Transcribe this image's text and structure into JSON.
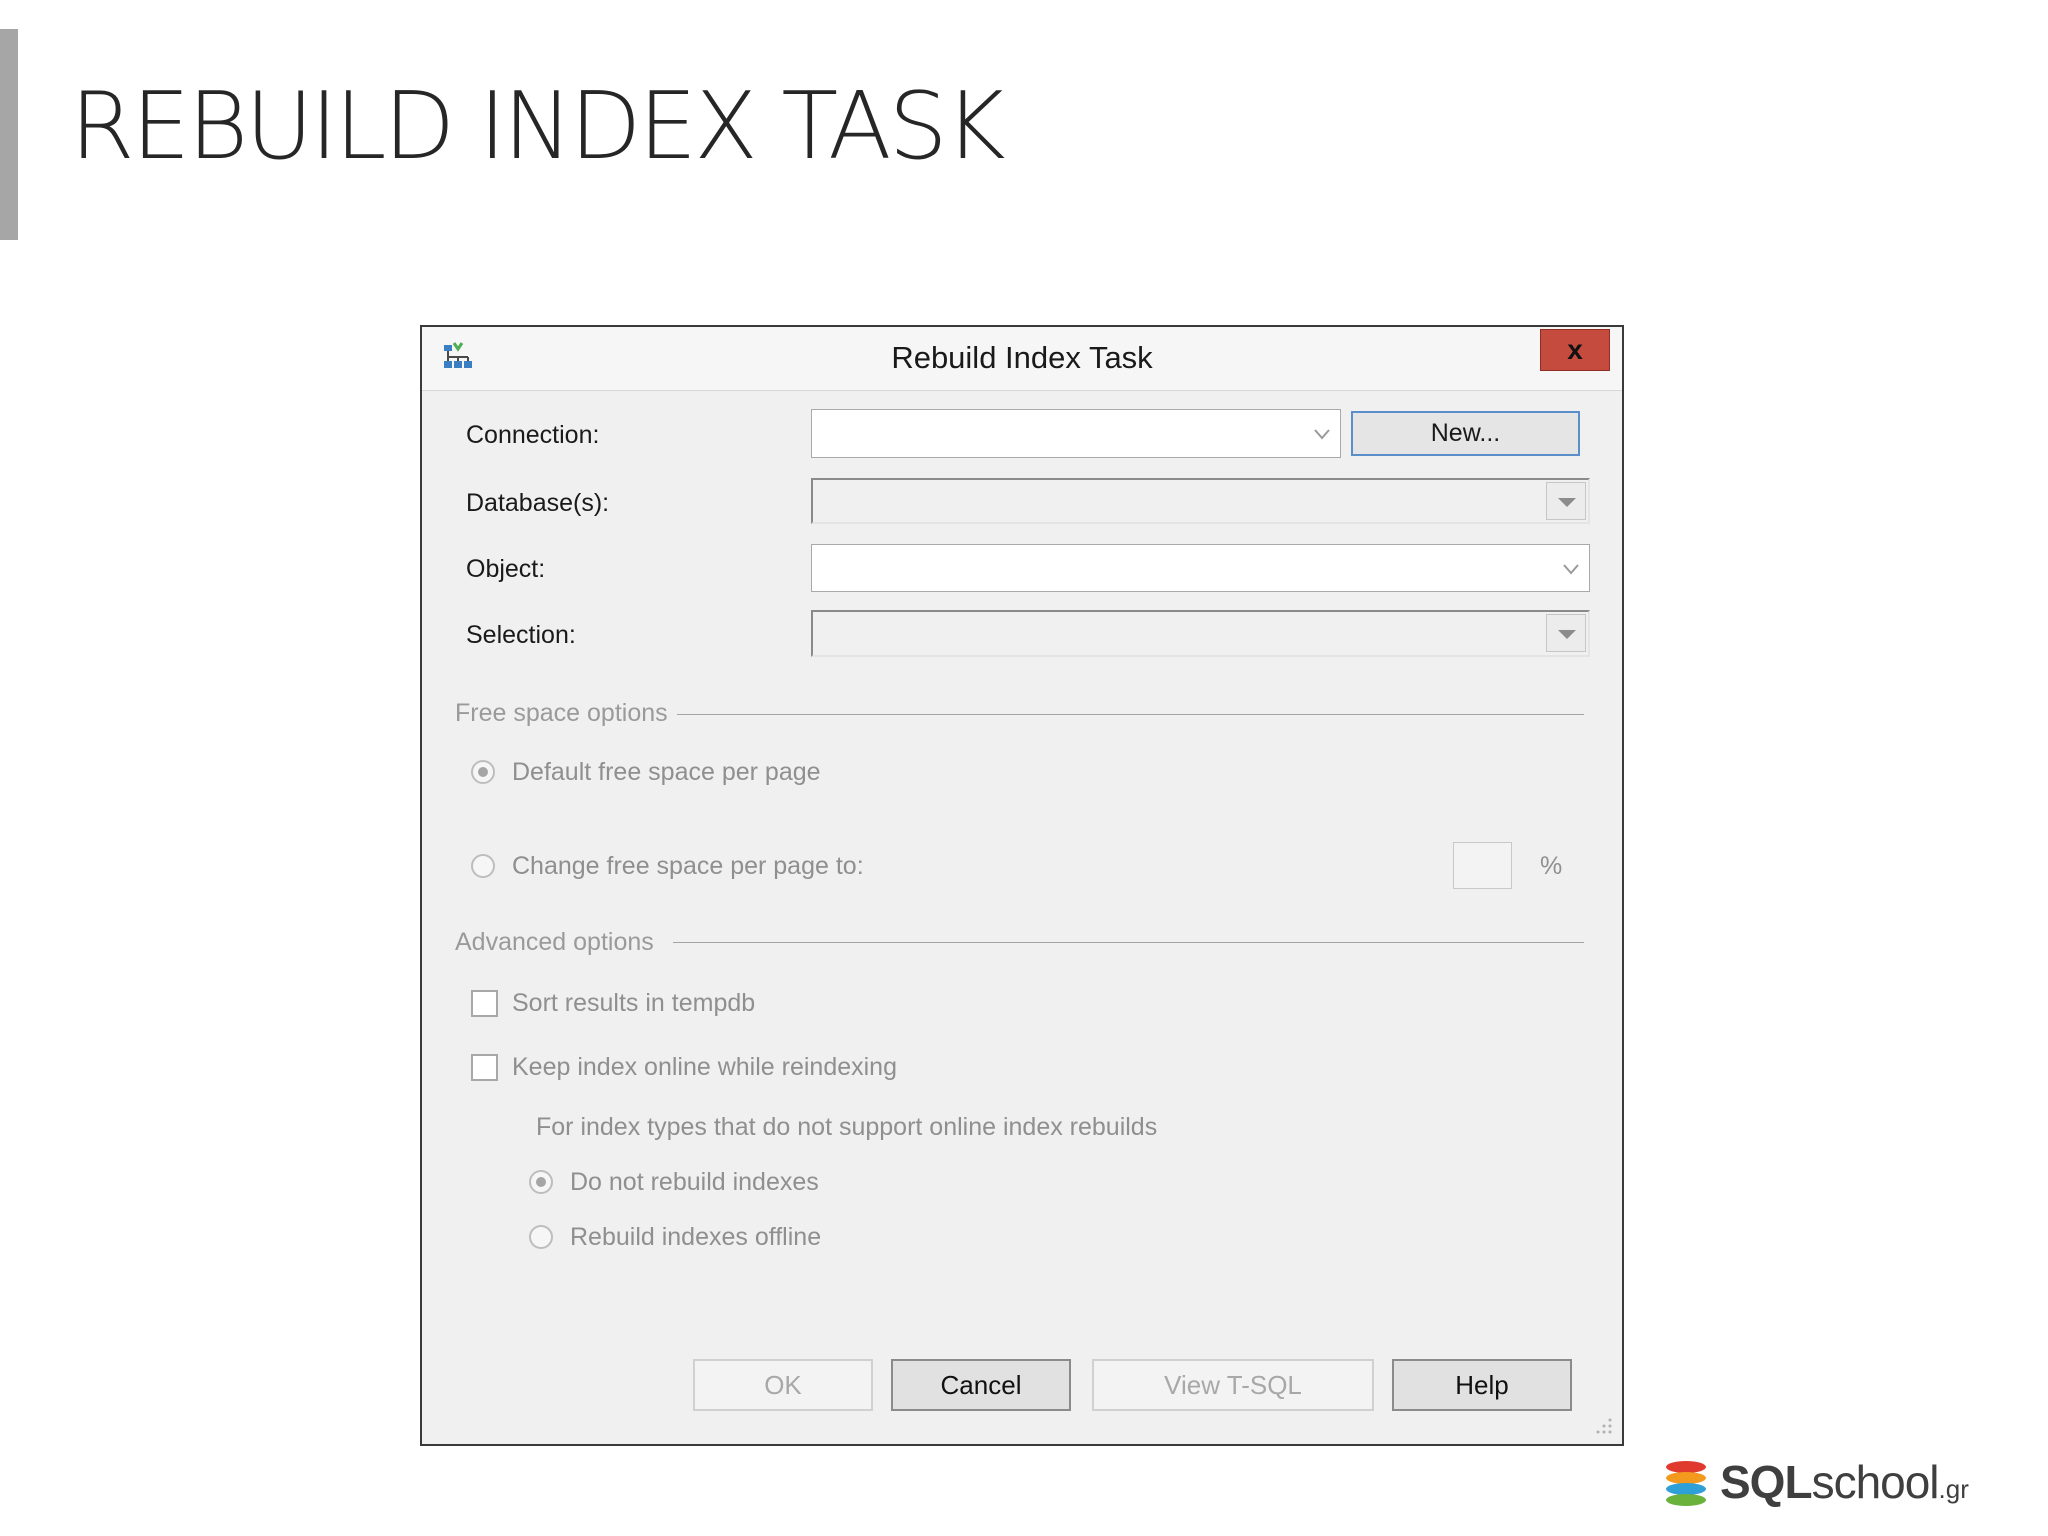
{
  "slide": {
    "title": "REBUILD INDEX TASK"
  },
  "dialog": {
    "title": "Rebuild Index Task",
    "close_label": "x",
    "fields": {
      "connection_label": "Connection:",
      "connection_value": "",
      "new_button": "New...",
      "databases_label": "Database(s):",
      "databases_value": "",
      "object_label": "Object:",
      "object_value": "",
      "selection_label": "Selection:",
      "selection_value": ""
    },
    "free_space": {
      "header": "Free space options",
      "default_option": "Default free space per page",
      "change_option": "Change free space per page to:",
      "percent_value": "",
      "percent_symbol": "%",
      "selected": "default"
    },
    "advanced": {
      "header": "Advanced options",
      "sort_tempdb": "Sort results in tempdb",
      "sort_tempdb_checked": false,
      "keep_online": "Keep index online while reindexing",
      "keep_online_checked": false,
      "note": "For index types that do not support online index rebuilds",
      "do_not_rebuild": "Do not rebuild indexes",
      "rebuild_offline": "Rebuild indexes offline",
      "selected": "do_not_rebuild"
    },
    "buttons": {
      "ok": "OK",
      "cancel": "Cancel",
      "view_tsql": "View T-SQL",
      "help": "Help"
    }
  },
  "logo": {
    "brand_bold": "SQL",
    "brand_light": "school",
    "suffix": ".gr"
  },
  "colors": {
    "close_button": "#c64b3f",
    "new_button_border": "#5b8fc9",
    "logo_stack": [
      "#e03a2f",
      "#f39a1e",
      "#2f9fd8",
      "#6bb23d"
    ]
  }
}
